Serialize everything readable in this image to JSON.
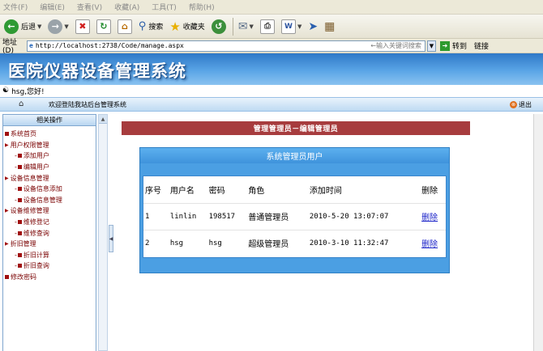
{
  "browser": {
    "menu": [
      "文件(F)",
      "编辑(E)",
      "查看(V)",
      "收藏(A)",
      "工具(T)",
      "帮助(H)"
    ],
    "toolbar": {
      "back": "后退",
      "search": "搜索",
      "favorites": "收藏夹"
    },
    "address": {
      "label": "地址(D)",
      "url": "http://localhost:2738/Code/manage.aspx",
      "search_hint": "←输入关键词搜索",
      "go": "转到",
      "links": "链接"
    }
  },
  "site": {
    "title": "医院仪器设备管理系统",
    "greeting": "hsg,您好!",
    "welcome": "欢迎登陆我站后台管理系统",
    "logout": "退出"
  },
  "sidebar": {
    "header": "相关操作",
    "items": [
      {
        "label": "系统首页",
        "level": 0
      },
      {
        "label": "用户权限管理",
        "level": 0
      },
      {
        "label": "添加用户",
        "level": 1
      },
      {
        "label": "编辑用户",
        "level": 1
      },
      {
        "label": "设备信息管理",
        "level": 0
      },
      {
        "label": "设备信息添加",
        "level": 1
      },
      {
        "label": "设备信息管理",
        "level": 1
      },
      {
        "label": "设备维修管理",
        "level": 0
      },
      {
        "label": "维修登记",
        "level": 1
      },
      {
        "label": "维修查询",
        "level": 1
      },
      {
        "label": "折旧管理",
        "level": 0
      },
      {
        "label": "折旧计算",
        "level": 1
      },
      {
        "label": "折旧查询",
        "level": 1
      },
      {
        "label": "修改密码",
        "level": 0
      }
    ]
  },
  "main": {
    "banner": "管理管理员－编辑管理员",
    "box_title": "系统管理员用户",
    "table": {
      "headers": [
        "序号",
        "用户名",
        "密码",
        "角色",
        "添加时间",
        "删除"
      ],
      "rows": [
        [
          "1",
          "linlin",
          "198517",
          "普通管理员",
          "2010-5-20 13:07:07",
          "删除"
        ],
        [
          "2",
          "hsg",
          "hsg",
          "超级管理员",
          "2010-3-10 11:32:47",
          "删除"
        ]
      ]
    }
  }
}
